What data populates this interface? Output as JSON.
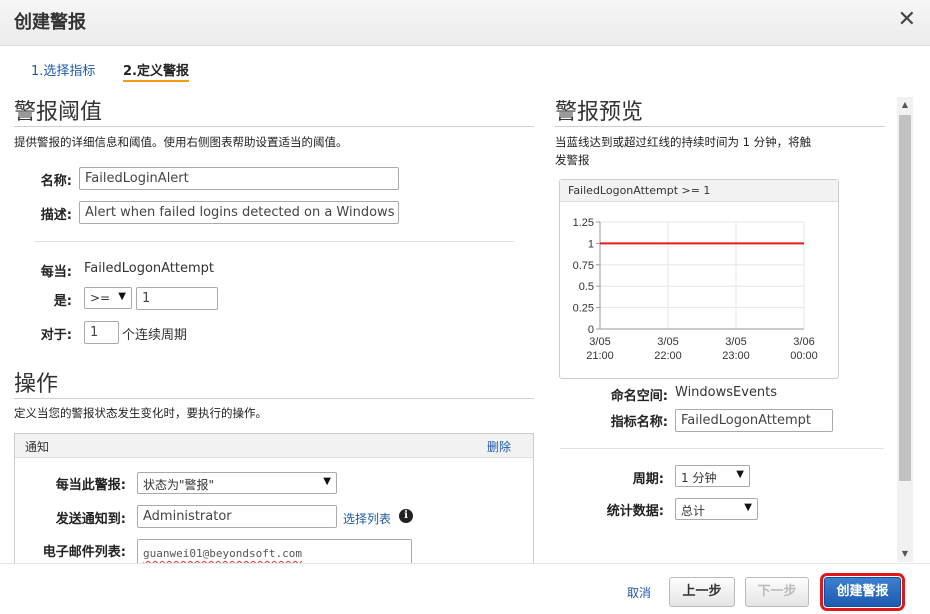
{
  "dialog": {
    "title": "创建警报",
    "close_glyph": "✕"
  },
  "steps": [
    {
      "label": "1.选择指标"
    },
    {
      "label": "2.定义警报"
    }
  ],
  "threshold": {
    "heading": "警报阈值",
    "description": "提供警报的详细信息和阈值。使用右侧图表帮助设置适当的阈值。",
    "name_label": "名称:",
    "name_value": "FailedLoginAlert",
    "desc_label": "描述:",
    "desc_value": "Alert when failed logins detected on a Windows ir",
    "whenever_label": "每当:",
    "whenever_value": "FailedLogonAttempt",
    "is_label": "是:",
    "operator": "&gt;=",
    "threshold_value": "1",
    "for_label": "对于:",
    "periods_value": "1",
    "periods_suffix": "个连续周期"
  },
  "actions": {
    "heading": "操作",
    "description": "定义当您的警报状态发生变化时，要执行的操作。",
    "notification_title": "通知",
    "delete_label": "删除",
    "whenever_state_label": "每当此警报:",
    "state_value": "状态为\"警报\"",
    "send_to_label": "发送通知到:",
    "send_to_value": "Administrator",
    "select_list_label": "选择列表",
    "info_glyph": "i",
    "email_list_label": "电子邮件列表:",
    "email_value": "guanwei01@beyondsoft.com"
  },
  "preview": {
    "heading": "警报预览",
    "description_line1": "当蓝线达到或超过红线的持续时间为 1 分钟，将触",
    "description_line2": "发警报",
    "namespace_label": "命名空间:",
    "namespace_value": "WindowsEvents",
    "metric_label": "指标名称:",
    "metric_value": "FailedLogonAttempt",
    "period_label": "周期:",
    "period_value": "1 分钟",
    "statistic_label": "统计数据:",
    "statistic_value": "总计"
  },
  "chart_data": {
    "type": "line",
    "title": "FailedLogonAttempt >= 1",
    "xlabel": "",
    "ylabel": "",
    "ylim": [
      0,
      1.25
    ],
    "y_ticks": [
      "0",
      "0.25",
      "0.5",
      "0.75",
      "1",
      "1.25"
    ],
    "x_ticks": [
      {
        "date": "3/05",
        "time": "21:00"
      },
      {
        "date": "3/05",
        "time": "22:00"
      },
      {
        "date": "3/05",
        "time": "23:00"
      },
      {
        "date": "3/06",
        "time": "00:00"
      }
    ],
    "grid": true,
    "series": [
      {
        "values": [
          1,
          1,
          1,
          1
        ],
        "color": "#e8191b"
      }
    ]
  },
  "footer": {
    "cancel_label": "取消",
    "prev_label": "上一步",
    "next_label": "下一步",
    "create_label": "创建警报"
  },
  "scrollbar": {
    "up_glyph": "▲",
    "down_glyph": "▼"
  },
  "colors": {
    "link": "#1e5aa8",
    "step_underline": "#f29b17",
    "primary": "#1d5bb0",
    "alarm_line": "#e8191b",
    "highlight": "#e0181b"
  }
}
